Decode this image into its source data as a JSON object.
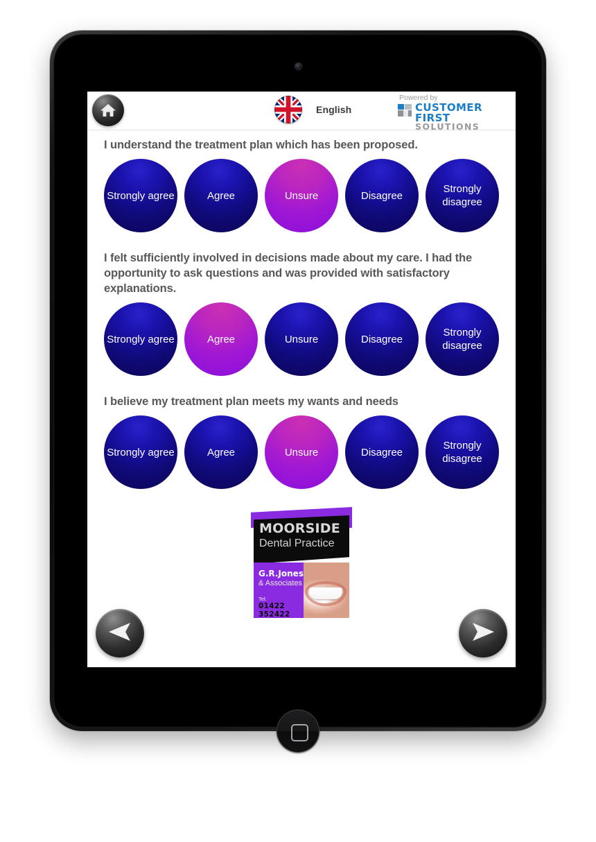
{
  "header": {
    "home_icon": "home-icon",
    "flag_icon": "uk-flag-icon",
    "language": "English",
    "brand": {
      "powered_by": "Powered by",
      "name_primary": "CUSTOMER FIRST",
      "name_secondary": "SOLUTIONS",
      "color_primary": "#1b7ec6",
      "color_secondary": "#9a9a9c"
    }
  },
  "survey": {
    "scale": [
      "Strongly agree",
      "Agree",
      "Unsure",
      "Disagree",
      "Strongly disagree"
    ],
    "colors": {
      "option_default": "#110a7e",
      "option_selected": "#a018d4",
      "question_text": "#58585a"
    },
    "questions": [
      {
        "text": "I understand the treatment plan which has been proposed.",
        "selected": "Unsure",
        "options": [
          {
            "label": "Strongly agree",
            "selected": false
          },
          {
            "label": "Agree",
            "selected": false
          },
          {
            "label": "Unsure",
            "selected": true
          },
          {
            "label": "Disagree",
            "selected": false
          },
          {
            "label": "Strongly disagree",
            "selected": false
          }
        ]
      },
      {
        "text": "I felt sufficiently involved in decisions made about my care. I had the opportunity to ask questions and was provided with satisfactory explanations.",
        "selected": "Agree",
        "options": [
          {
            "label": "Strongly agree",
            "selected": false
          },
          {
            "label": "Agree",
            "selected": true
          },
          {
            "label": "Unsure",
            "selected": false
          },
          {
            "label": "Disagree",
            "selected": false
          },
          {
            "label": "Strongly disagree",
            "selected": false
          }
        ]
      },
      {
        "text": "I believe my treatment plan meets my wants and needs",
        "selected": "Unsure",
        "options": [
          {
            "label": "Strongly agree",
            "selected": false
          },
          {
            "label": "Agree",
            "selected": false
          },
          {
            "label": "Unsure",
            "selected": true
          },
          {
            "label": "Disagree",
            "selected": false
          },
          {
            "label": "Strongly disagree",
            "selected": false
          }
        ]
      }
    ]
  },
  "advert": {
    "practice_name": "MOORSIDE",
    "practice_type": "Dental Practice",
    "company": "G.R.Jones",
    "associates": "& Associates",
    "tel_label": "Tel:",
    "tel_number": "01422 352422",
    "accent_color": "#8a2be2"
  },
  "navigation": {
    "prev_icon": "arrow-left-icon",
    "next_icon": "arrow-right-icon"
  },
  "device": {
    "camera_icon": "front-camera",
    "home_button_icon": "device-home-button"
  }
}
